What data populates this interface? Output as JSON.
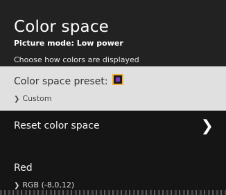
{
  "header": {
    "title": "Color space",
    "subtitle": "Picture mode: Low power",
    "description": "Choose how colors are displayed"
  },
  "items": {
    "preset": {
      "label": "Color space preset:",
      "value": "Custom",
      "swatch_colors": {
        "border": "#f4b13a",
        "fill": "#7b3bbf"
      }
    },
    "reset": {
      "label": "Reset color space",
      "icon": "chevron-right-icon"
    },
    "red": {
      "label": "Red",
      "value": "RGB (-8,0,12)"
    }
  },
  "colors": {
    "background": "#151515",
    "header_background": "#222222",
    "selected_row_background": "#e0e0e0"
  }
}
